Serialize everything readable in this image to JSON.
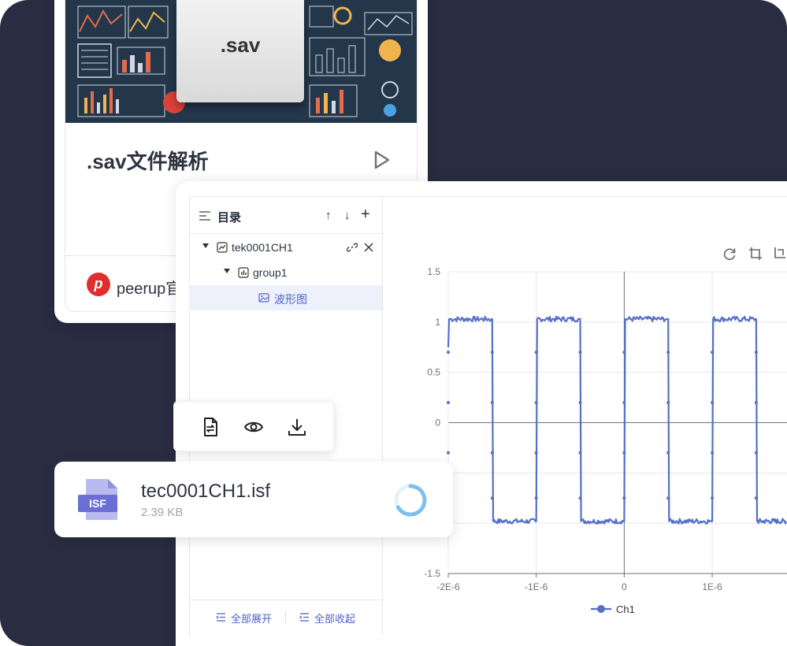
{
  "card": {
    "title": ".sav文件解析",
    "thumbnail_text": ".sav",
    "brand_text": "peerup官",
    "brand_logo_letter": "p"
  },
  "sidebar": {
    "title": "目录",
    "tree": [
      {
        "label": "tek0001CH1",
        "icon": "line-chart-icon",
        "expanded": true
      },
      {
        "label": "group1",
        "icon": "bar-chart-icon",
        "expanded": true
      },
      {
        "label": "波形图",
        "icon": "image-icon",
        "selected": true
      }
    ],
    "expand_all": "全部展开",
    "collapse_all": "全部收起"
  },
  "toolbar": {
    "icons": [
      "file-convert-icon",
      "eye-icon",
      "download-icon"
    ]
  },
  "file": {
    "badge": "ISF",
    "name": "tec0001CH1.isf",
    "size": "2.39 KB"
  },
  "colors": {
    "navy_bg": "#2a2d42",
    "accent": "#4f63c8",
    "series": "#5470c6",
    "file_icon": "#6b6fd4"
  },
  "chart_data": {
    "type": "line",
    "title": "",
    "xlabel": "",
    "ylabel": "",
    "xlim": [
      -2e-06,
      1.85e-06
    ],
    "ylim": [
      -1.5,
      1.5
    ],
    "yticks": [
      "1.5",
      "1",
      "0.5",
      "0",
      "-0.5",
      "-1",
      "-1.5"
    ],
    "yticks_values": [
      1.5,
      1,
      0.5,
      0,
      -0.5,
      -1,
      -1.5
    ],
    "xticks": [
      "-2E-6",
      "-1E-6",
      "0",
      "1E-6"
    ],
    "xticks_values": [
      -2e-06,
      -1e-06,
      0,
      1e-06
    ],
    "grid": true,
    "legend": "bottom-center",
    "series": [
      {
        "name": "Ch1",
        "square_wave": {
          "high": 1.03,
          "low": -0.98,
          "period": 1e-06,
          "rising_edges": [
            -2e-06,
            -1e-06,
            0,
            1e-06
          ],
          "falling_edges": [
            -1.5e-06,
            -5e-07,
            5e-07,
            1.5e-06
          ]
        }
      }
    ]
  }
}
